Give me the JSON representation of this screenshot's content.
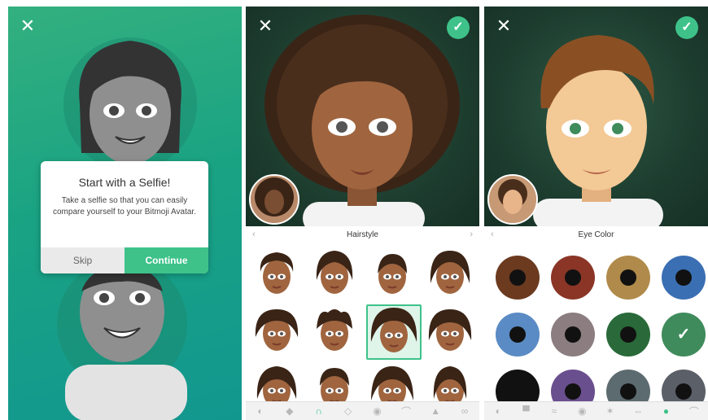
{
  "panel1": {
    "close_glyph": "✕",
    "dialog": {
      "title": "Start with a Selfie!",
      "body": "Take a selfie so that you can easily compare yourself to your Bitmoji Avatar.",
      "skip": "Skip",
      "continue": "Continue"
    }
  },
  "panel2": {
    "close_glyph": "✕",
    "confirm_glyph": "✓",
    "section_title": "Hairstyle",
    "prev_glyph": "‹",
    "next_glyph": "›",
    "selected_index": 6,
    "tabs": [
      "skin-tone-icon",
      "hair-icon",
      "hairstyle-icon",
      "hair-shine-icon",
      "eye-icon",
      "eyebrow-icon",
      "nose-icon",
      "glasses-icon"
    ],
    "active_tab": 2
  },
  "panel3": {
    "close_glyph": "✕",
    "confirm_glyph": "✓",
    "section_title": "Eye Color",
    "prev_glyph": "‹",
    "swatches": [
      "#6b3a1f",
      "#8a3526",
      "#b08a4a",
      "#3a6fb3",
      "#5a8bc4",
      "#8b7d80",
      "#2a6a3a",
      "#3f8b5c",
      "#111111",
      "#6a4f8f",
      "#5c6b70",
      "#5b5f68"
    ],
    "selected_index": 7,
    "tabs": [
      "skin-tone-icon",
      "hat-icon",
      "mustache-icon",
      "eye-icon",
      "eye-detail-icon",
      "eye-spacing-icon",
      "eye-color-icon",
      "eyebrow-icon"
    ],
    "active_tab": 6
  },
  "colors": {
    "accent": "#3ec28a",
    "gradient_top": "#33b07f",
    "gradient_bottom": "#12978f"
  }
}
